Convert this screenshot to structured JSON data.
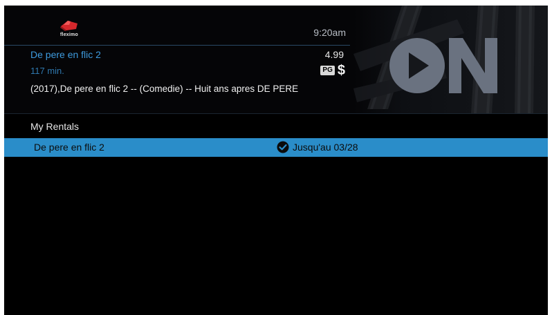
{
  "brand": {
    "name": "fleximo",
    "logo_icon": "fleximo-logo-icon"
  },
  "header": {
    "clock": "9:20am",
    "title": "De pere en flic 2",
    "price": "4.99",
    "duration": "117 min.",
    "rating": "PG",
    "price_icon": "dollar-icon",
    "description": "(2017),De pere en flic 2  -- (Comedie) -- Huit ans apres DE PERE",
    "hero_text": "ON"
  },
  "section": {
    "title": "My Rentals"
  },
  "rentals": [
    {
      "title": "De pere en flic 2",
      "status_icon": "check-circle-icon",
      "expiry": "Jusqu'au 03/28"
    }
  ],
  "colors": {
    "accent": "#2a8dc9",
    "title_blue": "#3e9bde",
    "background": "#000000"
  }
}
